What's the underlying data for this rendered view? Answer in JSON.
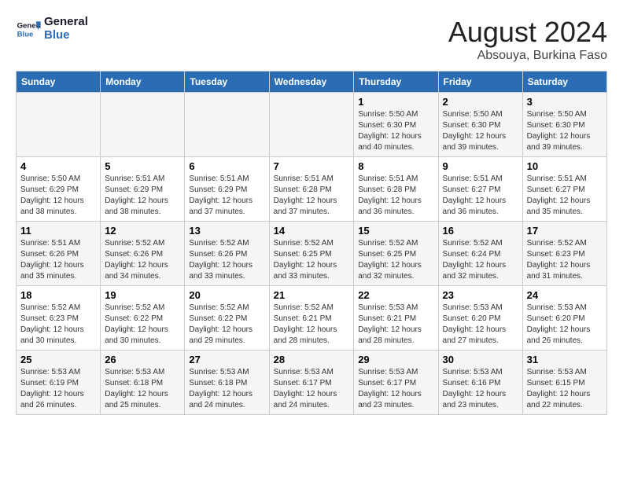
{
  "logo": {
    "line1": "General",
    "line2": "Blue"
  },
  "title": "August 2024",
  "subtitle": "Absouya, Burkina Faso",
  "days_of_week": [
    "Sunday",
    "Monday",
    "Tuesday",
    "Wednesday",
    "Thursday",
    "Friday",
    "Saturday"
  ],
  "weeks": [
    [
      {
        "day": "",
        "info": ""
      },
      {
        "day": "",
        "info": ""
      },
      {
        "day": "",
        "info": ""
      },
      {
        "day": "",
        "info": ""
      },
      {
        "day": "1",
        "info": "Sunrise: 5:50 AM\nSunset: 6:30 PM\nDaylight: 12 hours\nand 40 minutes."
      },
      {
        "day": "2",
        "info": "Sunrise: 5:50 AM\nSunset: 6:30 PM\nDaylight: 12 hours\nand 39 minutes."
      },
      {
        "day": "3",
        "info": "Sunrise: 5:50 AM\nSunset: 6:30 PM\nDaylight: 12 hours\nand 39 minutes."
      }
    ],
    [
      {
        "day": "4",
        "info": "Sunrise: 5:50 AM\nSunset: 6:29 PM\nDaylight: 12 hours\nand 38 minutes."
      },
      {
        "day": "5",
        "info": "Sunrise: 5:51 AM\nSunset: 6:29 PM\nDaylight: 12 hours\nand 38 minutes."
      },
      {
        "day": "6",
        "info": "Sunrise: 5:51 AM\nSunset: 6:29 PM\nDaylight: 12 hours\nand 37 minutes."
      },
      {
        "day": "7",
        "info": "Sunrise: 5:51 AM\nSunset: 6:28 PM\nDaylight: 12 hours\nand 37 minutes."
      },
      {
        "day": "8",
        "info": "Sunrise: 5:51 AM\nSunset: 6:28 PM\nDaylight: 12 hours\nand 36 minutes."
      },
      {
        "day": "9",
        "info": "Sunrise: 5:51 AM\nSunset: 6:27 PM\nDaylight: 12 hours\nand 36 minutes."
      },
      {
        "day": "10",
        "info": "Sunrise: 5:51 AM\nSunset: 6:27 PM\nDaylight: 12 hours\nand 35 minutes."
      }
    ],
    [
      {
        "day": "11",
        "info": "Sunrise: 5:51 AM\nSunset: 6:26 PM\nDaylight: 12 hours\nand 35 minutes."
      },
      {
        "day": "12",
        "info": "Sunrise: 5:52 AM\nSunset: 6:26 PM\nDaylight: 12 hours\nand 34 minutes."
      },
      {
        "day": "13",
        "info": "Sunrise: 5:52 AM\nSunset: 6:26 PM\nDaylight: 12 hours\nand 33 minutes."
      },
      {
        "day": "14",
        "info": "Sunrise: 5:52 AM\nSunset: 6:25 PM\nDaylight: 12 hours\nand 33 minutes."
      },
      {
        "day": "15",
        "info": "Sunrise: 5:52 AM\nSunset: 6:25 PM\nDaylight: 12 hours\nand 32 minutes."
      },
      {
        "day": "16",
        "info": "Sunrise: 5:52 AM\nSunset: 6:24 PM\nDaylight: 12 hours\nand 32 minutes."
      },
      {
        "day": "17",
        "info": "Sunrise: 5:52 AM\nSunset: 6:23 PM\nDaylight: 12 hours\nand 31 minutes."
      }
    ],
    [
      {
        "day": "18",
        "info": "Sunrise: 5:52 AM\nSunset: 6:23 PM\nDaylight: 12 hours\nand 30 minutes."
      },
      {
        "day": "19",
        "info": "Sunrise: 5:52 AM\nSunset: 6:22 PM\nDaylight: 12 hours\nand 30 minutes."
      },
      {
        "day": "20",
        "info": "Sunrise: 5:52 AM\nSunset: 6:22 PM\nDaylight: 12 hours\nand 29 minutes."
      },
      {
        "day": "21",
        "info": "Sunrise: 5:52 AM\nSunset: 6:21 PM\nDaylight: 12 hours\nand 28 minutes."
      },
      {
        "day": "22",
        "info": "Sunrise: 5:53 AM\nSunset: 6:21 PM\nDaylight: 12 hours\nand 28 minutes."
      },
      {
        "day": "23",
        "info": "Sunrise: 5:53 AM\nSunset: 6:20 PM\nDaylight: 12 hours\nand 27 minutes."
      },
      {
        "day": "24",
        "info": "Sunrise: 5:53 AM\nSunset: 6:20 PM\nDaylight: 12 hours\nand 26 minutes."
      }
    ],
    [
      {
        "day": "25",
        "info": "Sunrise: 5:53 AM\nSunset: 6:19 PM\nDaylight: 12 hours\nand 26 minutes."
      },
      {
        "day": "26",
        "info": "Sunrise: 5:53 AM\nSunset: 6:18 PM\nDaylight: 12 hours\nand 25 minutes."
      },
      {
        "day": "27",
        "info": "Sunrise: 5:53 AM\nSunset: 6:18 PM\nDaylight: 12 hours\nand 24 minutes."
      },
      {
        "day": "28",
        "info": "Sunrise: 5:53 AM\nSunset: 6:17 PM\nDaylight: 12 hours\nand 24 minutes."
      },
      {
        "day": "29",
        "info": "Sunrise: 5:53 AM\nSunset: 6:17 PM\nDaylight: 12 hours\nand 23 minutes."
      },
      {
        "day": "30",
        "info": "Sunrise: 5:53 AM\nSunset: 6:16 PM\nDaylight: 12 hours\nand 23 minutes."
      },
      {
        "day": "31",
        "info": "Sunrise: 5:53 AM\nSunset: 6:15 PM\nDaylight: 12 hours\nand 22 minutes."
      }
    ]
  ]
}
